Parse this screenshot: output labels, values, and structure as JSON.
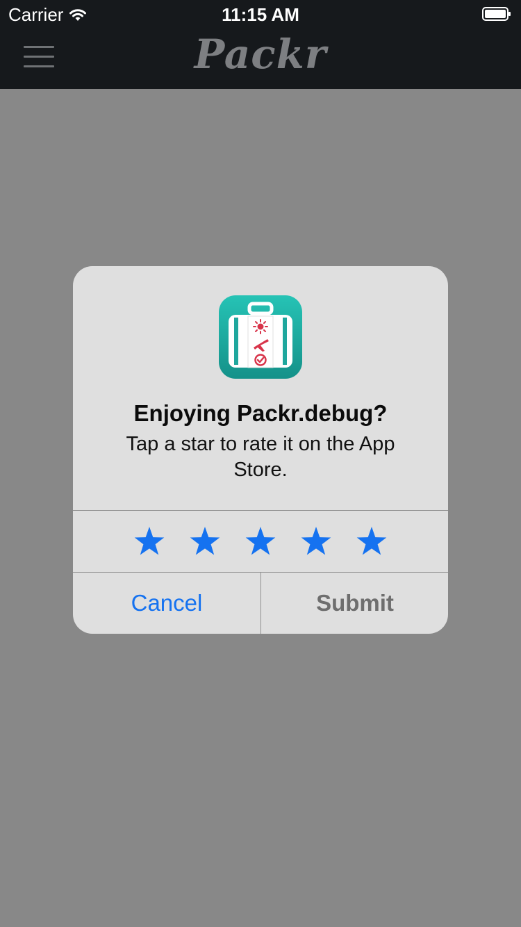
{
  "status_bar": {
    "carrier": "Carrier",
    "time": "11:15 AM",
    "wifi_icon": "wifi-icon",
    "battery_icon": "battery-icon"
  },
  "nav_bar": {
    "title": "Packr",
    "menu_icon": "hamburger-menu-icon"
  },
  "dialog": {
    "app_icon": "suitcase-app-icon",
    "title": "Enjoying Packr.debug?",
    "message": "Tap a star to rate it on the App Store.",
    "stars": [
      {
        "icon": "star-icon"
      },
      {
        "icon": "star-icon"
      },
      {
        "icon": "star-icon"
      },
      {
        "icon": "star-icon"
      },
      {
        "icon": "star-icon"
      }
    ],
    "cancel_label": "Cancel",
    "submit_label": "Submit"
  },
  "colors": {
    "bar_background": "#16191c",
    "overlay": "#888888",
    "dialog_background": "#dfdfdf",
    "accent_blue": "#1572f0",
    "submit_disabled": "#6e6e6e",
    "icon_teal": "#20b3a8",
    "icon_red": "#d8344a"
  }
}
